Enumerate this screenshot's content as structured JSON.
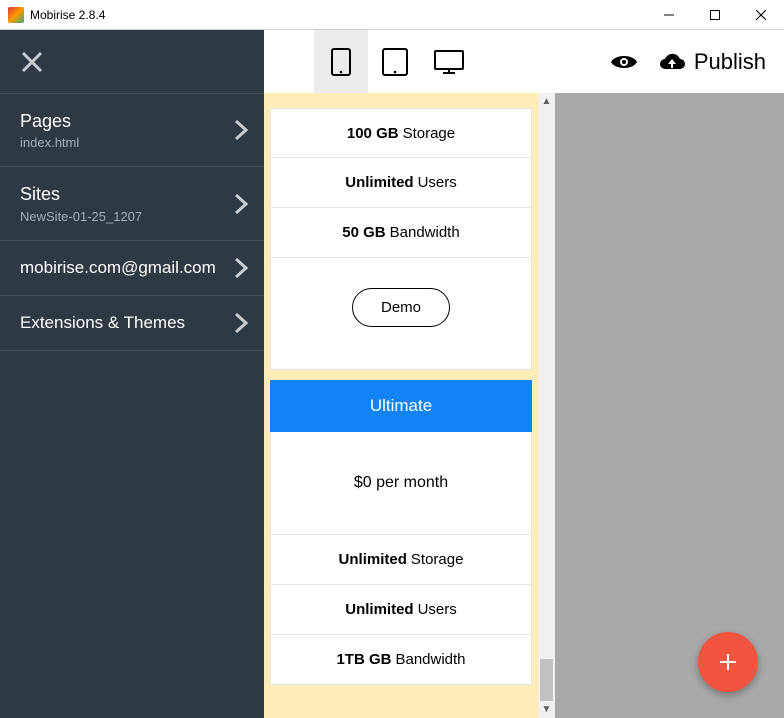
{
  "window": {
    "title": "Mobirise 2.8.4"
  },
  "toolbar": {
    "publish": "Publish"
  },
  "sidebar": {
    "pages_label": "Pages",
    "pages_sub": "index.html",
    "sites_label": "Sites",
    "sites_sub": "NewSite-01-25_1207",
    "account": "mobirise.com@gmail.com",
    "extensions": "Extensions & Themes"
  },
  "canvas": {
    "plan1": {
      "f1_bold": "100 GB",
      "f1_rest": "Storage",
      "f2_bold": "Unlimited",
      "f2_rest": "Users",
      "f3_bold": "50 GB",
      "f3_rest": "Bandwidth",
      "button": "Demo"
    },
    "plan2": {
      "name": "Ultimate",
      "price": "$0 per month",
      "f1_bold": "Unlimited",
      "f1_rest": "Storage",
      "f2_bold": "Unlimited",
      "f2_rest": "Users",
      "f3_bold": "1TB GB",
      "f3_rest": "Bandwidth"
    }
  }
}
